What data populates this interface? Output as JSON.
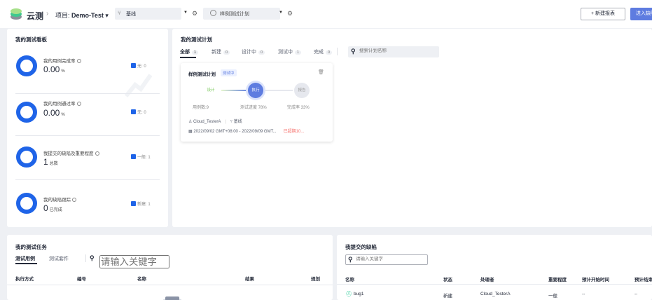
{
  "topbar": {
    "brand": "云测",
    "breadcrumb_sep": "›",
    "project_label": "项目: ",
    "project_name": "Demo-Test",
    "project_caret": "▾",
    "branch_value": "基线",
    "plan_value": "样例测试计划",
    "new_report_label": "+ 新建报表",
    "enter_label": "进入缺陷"
  },
  "dashboard": {
    "title": "我的测试看板",
    "metrics": [
      {
        "label": "我的用例完成率",
        "value": "0.00",
        "unit": "%",
        "legend": "无: 0"
      },
      {
        "label": "我的用例通过率",
        "value": "0.00",
        "unit": "%",
        "legend": "无: 0"
      },
      {
        "label": "我提交的缺陷及重要程度",
        "value": "1",
        "unit": "总数",
        "legend": "一般: 1"
      },
      {
        "label": "我的缺陷跟踪",
        "value": "0",
        "unit": "已完成",
        "legend": "新建: 1"
      }
    ]
  },
  "plans": {
    "title": "我的测试计划",
    "tabs": [
      {
        "label": "全部",
        "count": "1"
      },
      {
        "label": "新建",
        "count": "0"
      },
      {
        "label": "设计中",
        "count": "0"
      },
      {
        "label": "测试中",
        "count": "1"
      },
      {
        "label": "完成",
        "count": "0"
      }
    ],
    "search_placeholder": "搜索计划名称",
    "card": {
      "name": "样例测试计划",
      "status": "测试中",
      "steps": [
        "设计",
        "执行",
        "报告"
      ],
      "case_count": "用例数:9",
      "progress": "测试进度 78%",
      "completion": "完成率 33%",
      "owner": "Cloud_TesterA",
      "branch": "基线",
      "date_range": "2022/09/02 GMT+08:00 - 2022/09/09 GMT...",
      "overdue": "已超期10..."
    }
  },
  "tasks": {
    "title": "我的测试任务",
    "tabs": [
      "测试用例",
      "测试套件"
    ],
    "search_placeholder": "请输入关键字",
    "columns": [
      "执行方式",
      "编号",
      "名称",
      "结果",
      "规划"
    ]
  },
  "defects": {
    "title": "我提交的缺陷",
    "search_placeholder": "请输入关键字",
    "columns": [
      "名称",
      "状态",
      "处理者",
      "重要程度",
      "预计开始时间",
      "预计结束"
    ],
    "rows": [
      {
        "name": "bug1",
        "status": "新建",
        "handler": "Cloud_TesterA",
        "severity": "一般",
        "start": "--",
        "end": "--"
      }
    ]
  },
  "colors": {
    "accent": "#5e7ce0",
    "ring": "#1f64e8",
    "overdue": "#f66f6a"
  }
}
